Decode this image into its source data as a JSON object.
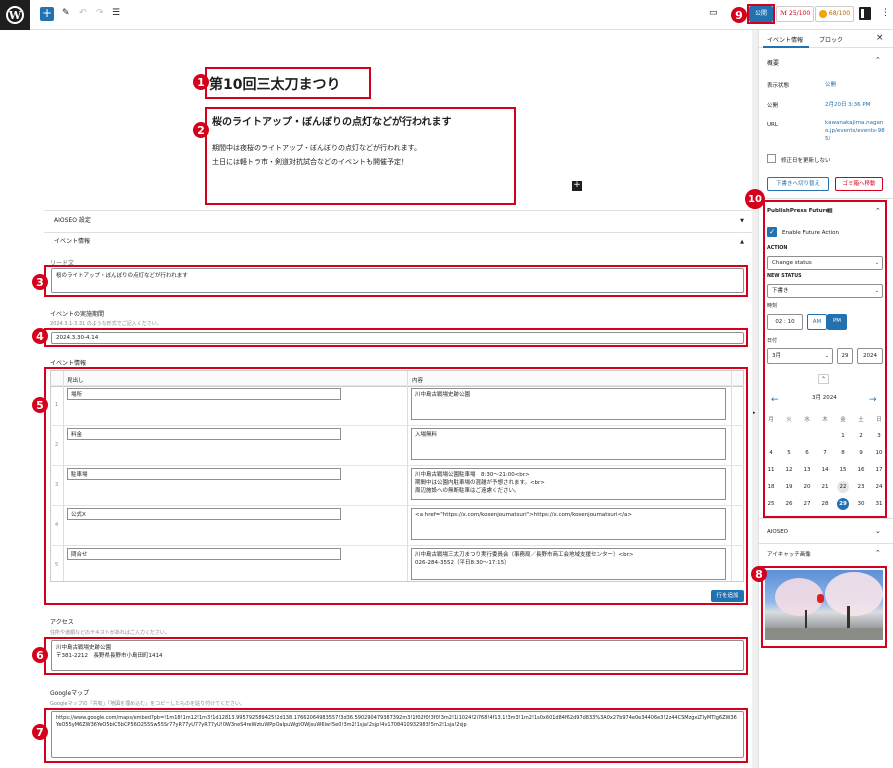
{
  "toolbar": {
    "publish": "公開",
    "seo_score": "25/100",
    "score2": "68/100"
  },
  "post": {
    "title": "第10回三太刀まつり",
    "subtitle": "桜のライトアップ・ぼんぼりの点灯などが行われます",
    "body1": "期間中は夜桜のライトアップ・ぼんぼりの点灯などが行われます。",
    "body2": "土日には軽トラ市・剣道対抗試合などのイベントも開催予定！"
  },
  "meta": {
    "aioseo": "AIOSEO 設定",
    "event_info": "イベント情報",
    "lead_label": "リード文",
    "lead_value": "桜のライトアップ・ぼんぼりの点灯などが行われます",
    "period_label": "イベントの実施期間",
    "period_hint": "2024.3.1-3.31 のような形式でご記入ください。",
    "period_value": "2024.3.30-4.14",
    "table_label": "イベント情報",
    "col_head": "見出し",
    "col_content": "内容",
    "rows": [
      {
        "num": "1",
        "head": "場所",
        "content": "川中島古戦場史跡公園"
      },
      {
        "num": "2",
        "head": "料金",
        "content": "入場無料"
      },
      {
        "num": "3",
        "head": "駐車場",
        "content": "川中島古戦場公園駐車場　8:30〜21:00<br>\n期間中は公園内駐車場の混雑が予想されます。<br>\n周辺施設への無断駐車はご遠慮ください。"
      },
      {
        "num": "4",
        "head": "公式X",
        "content": "<a href=\"https://x.com/kosenjoumatsuri\">https://x.com/kosenjoumatsuri</a>"
      },
      {
        "num": "5",
        "head": "問合せ",
        "content": "川中島古戦場三太刀まつり実行委員会（事務局／長野市商工会地域支援センター）<br>\n026-284-3552（平日8:30〜17:15）"
      }
    ],
    "add_row": "行を追加",
    "access_label": "アクセス",
    "access_hint": "住所や道順などのテキストがあればご入力ください。",
    "access_value": "川中島古戦場史跡公園\n〒381-2212　長野県長野市小島田町1414",
    "map_label": "Googleマップ",
    "map_hint": "Googleマップの「共有」「地図を埋め込む」をコピーしたものを貼り付けてください。",
    "map_value": "https://www.google.com/maps/embed?pb=!1m18!1m12!1m3!1d12813.995792589425!2d138.17662064983557!3d36.590290479387392m3!1f02f0!3f0!3m2!1i1024!2i768!4f13.1!3m3!1m2!1s0x601d84f62d97d833%3A0x27b974e0e34406e3!2z44CSMzgxLTIyMTIg6ZW36YeO55yM6ZW36YeO5biC5bCP56O255Sw55Sr77yR77yU77yR77yU!0W3neS4reWztuWPpOaIpuWgtOWjsuW6lw!5e0!3m2!1sja!2sjp!4v1708410932983!5m2!1sja!2sjp"
  },
  "markers": [
    "1",
    "2",
    "3",
    "4",
    "5",
    "6",
    "7",
    "8",
    "9",
    "10"
  ],
  "sidebar": {
    "tab1": "イベント情報",
    "tab2": "ブロック",
    "close": "×",
    "summary": "概要",
    "visibility_label": "表示状態",
    "visibility_value": "公開",
    "publish_label": "公開",
    "publish_value": "2月20日 3:36 PM",
    "url_label": "URL",
    "url_value": "kawanakajima.nagano.jp/events/events-985/",
    "sticky": "修正日を更新しない",
    "draft_btn": "下書きへ切り替え",
    "trash_btn": "ゴミ箱へ移動",
    "ppf_title": "PublishPress Future",
    "enable": "Enable Future Action",
    "action_label": "ACTION",
    "action_value": "Change status",
    "status_label": "NEW STATUS",
    "status_value": "下書き",
    "time_label": "時刻",
    "time_value": "02 : 10",
    "am": "AM",
    "pm": "PM",
    "date_label": "日付",
    "month": "3月",
    "day": "29",
    "year": "2024",
    "cal_title": "3月 2024",
    "weekdays": [
      "月",
      "火",
      "水",
      "木",
      "金",
      "土",
      "日"
    ],
    "aioseo": "AIOSEO",
    "featured": "アイキャッチ画像"
  },
  "colors": {
    "accent": "#2271b1",
    "marker": "#d5001c"
  }
}
